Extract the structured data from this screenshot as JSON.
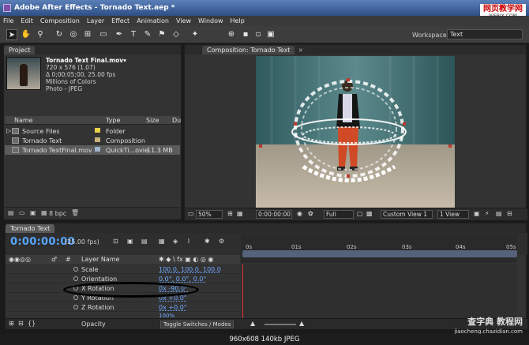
{
  "window": {
    "title": "Adobe After Effects - Tornado Text.aep *",
    "watermark_top": "网页教学网",
    "watermark_top_sub": "WEBJX.COM"
  },
  "menu": [
    "File",
    "Edit",
    "Composition",
    "Layer",
    "Effect",
    "Animation",
    "View",
    "Window",
    "Help"
  ],
  "toolbar": {
    "workspace_label": "Workspace:",
    "workspace_value": "Text"
  },
  "project": {
    "tab": "Project",
    "footage": {
      "name": "Tornado Text Final.mov▾",
      "dims": "720 x 576 (1.07)",
      "duration": "Δ 0;00;05;00, 25.00 fps",
      "colors": "Millions of Colors",
      "codec": "Photo - JPEG"
    },
    "columns": {
      "name": "Name",
      "type": "Type",
      "size": "Size",
      "dur": "Du"
    },
    "items": [
      {
        "name": "Source Files",
        "type": "Folder",
        "size": "",
        "color": "#e8d24a"
      },
      {
        "name": "Tornado Text",
        "type": "Composition",
        "size": "",
        "color": "#c9b27a"
      },
      {
        "name": "Tornado TextFinal.mov",
        "type": "QuickTi...ovie",
        "size": "11.3 MB",
        "color": "#9fb4cc"
      }
    ],
    "footer_bpc": "8 bpc"
  },
  "viewer": {
    "tab": "Composition: Tornado Text",
    "zoom": "50%",
    "time": "0:00:00:00",
    "resolution": "Full",
    "view": "Custom View 1",
    "views": "1 View"
  },
  "timeline": {
    "tab": "Tornado Text",
    "timecode": "0:00:00:00",
    "fps": "(25.00 fps)",
    "layer_name_header": "Layer Name",
    "ruler": [
      "0s",
      "01s",
      "02s",
      "03s",
      "04s",
      "05s"
    ],
    "properties": [
      {
        "name": "Scale",
        "value": "100.0, 100.0, 100.0"
      },
      {
        "name": "Orientation",
        "value": "0.0°, 0.0°, 0.0°"
      },
      {
        "name": "X Rotation",
        "value": "0x -90.0°"
      },
      {
        "name": "Y Rotation",
        "value": "0x +0.0°"
      },
      {
        "name": "Z Rotation",
        "value": "0x +0.0°"
      },
      {
        "name": "Opacity",
        "value": "100%"
      }
    ],
    "toggle_label": "Toggle Switches / Modes"
  },
  "status": {
    "text": "960x608  140kb  JPEG",
    "watermark_main": "查字典 教程网",
    "watermark_url": "jiaocheng.chazidian.com"
  }
}
